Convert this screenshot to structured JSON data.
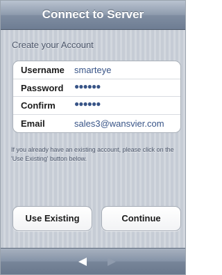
{
  "navbar": {
    "title": "Connect to Server"
  },
  "section": {
    "header": "Create your Account"
  },
  "form": {
    "fields": [
      {
        "label": "Username",
        "value": "smarteye"
      },
      {
        "label": "Password",
        "value": "●●●●●●"
      },
      {
        "label": "Confirm",
        "value": "●●●●●●"
      },
      {
        "label": "Email",
        "value": "sales3@wansvier.com"
      }
    ]
  },
  "info": {
    "text": "If you already have an existing account, please click on the 'Use Existing' button below."
  },
  "buttons": {
    "use_existing": "Use Existing",
    "continue": "Continue"
  },
  "toolbar": {
    "back_icon": "back-arrow-icon",
    "forward_icon": "forward-arrow-icon"
  },
  "colors": {
    "value_text": "#385487",
    "nav_bar": "#7f8da1"
  }
}
